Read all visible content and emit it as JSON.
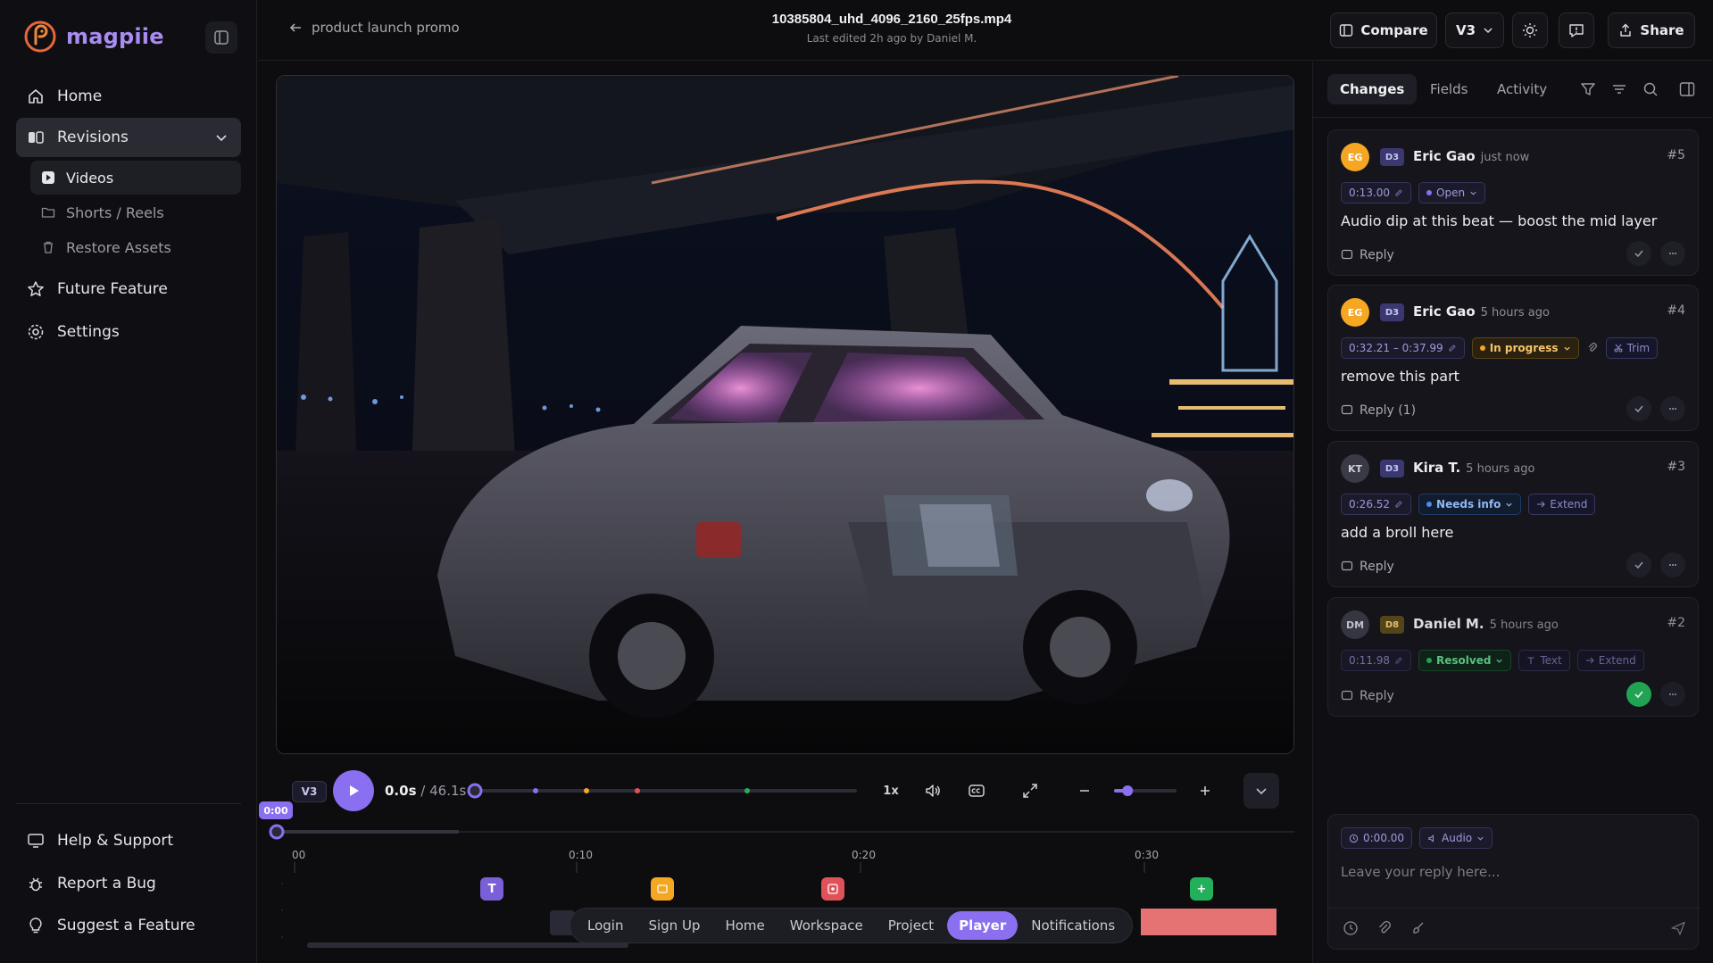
{
  "app": {
    "name": "magpiie"
  },
  "sidebar": {
    "nav": [
      {
        "label": "Home",
        "icon": "home-icon"
      },
      {
        "label": "Revisions",
        "icon": "revisions-icon"
      },
      {
        "label": "Future Feature",
        "icon": "star-icon"
      },
      {
        "label": "Settings",
        "icon": "gear-icon"
      }
    ],
    "sub": [
      {
        "label": "Videos",
        "icon": "play-square-icon"
      },
      {
        "label": "Shorts / Reels",
        "icon": "folder-icon"
      },
      {
        "label": "Restore Assets",
        "icon": "trash-icon"
      }
    ],
    "footer": [
      {
        "label": "Help & Support",
        "icon": "monitor-icon"
      },
      {
        "label": "Report a Bug",
        "icon": "bug-icon"
      },
      {
        "label": "Suggest a Feature",
        "icon": "lightbulb-icon"
      }
    ]
  },
  "header": {
    "back_label": "product launch promo",
    "file_name": "10385804_uhd_4096_2160_25fps.mp4",
    "subtitle": "Last edited 2h ago by Daniel M.",
    "compare_label": "Compare",
    "version_label": "V3",
    "share_label": "Share"
  },
  "player": {
    "version_chip": "V3",
    "current_time": "0.0s",
    "separator": "/",
    "duration": "46.1s",
    "speed": "1x",
    "progress": 0.0,
    "zoom_level": 0.2,
    "playhead_label": "0:00"
  },
  "timeline": {
    "ticks": [
      "00",
      "0:10",
      "0:20",
      "0:30"
    ],
    "markers": [
      {
        "label": "T",
        "color": "#7a5fd8"
      },
      {
        "label": "",
        "color": "#f5a623"
      },
      {
        "label": "",
        "color": "#e0525a"
      },
      {
        "label": "+",
        "color": "#22b15a"
      }
    ],
    "scrubber_dots": [
      "#8a6ff0",
      "#f5a623",
      "#e0525a",
      "#22b15a"
    ]
  },
  "bottom_nav": {
    "items": [
      "Login",
      "Sign Up",
      "Home",
      "Workspace",
      "Project",
      "Player",
      "Notifications"
    ],
    "active": "Player"
  },
  "panel": {
    "tabs": [
      "Changes",
      "Fields",
      "Activity"
    ],
    "active_tab": "Changes",
    "comments": [
      {
        "initials": "EG",
        "avatar_color": "#f5a623",
        "version": "D3",
        "author": "Eric Gao",
        "when": "just now",
        "number": "#5",
        "timestamp": "0:13.00",
        "status": "Open",
        "status_color": "#8a6ff0",
        "tags": [],
        "text": "Audio dip at this beat — boost the mid layer",
        "reply": "Reply",
        "resolved": false
      },
      {
        "initials": "EG",
        "avatar_color": "#f5a623",
        "version": "D3",
        "author": "Eric Gao",
        "when": "5 hours ago",
        "number": "#4",
        "timestamp": "0:32.21 – 0:37.99",
        "status": "In progress",
        "status_color": "#f5a623",
        "tags": [
          "Trim"
        ],
        "text": "remove this part",
        "reply": "Reply (1)",
        "resolved": false
      },
      {
        "initials": "KT",
        "avatar_color": "#3a3a46",
        "version": "D3",
        "author": "Kira T.",
        "when": "5 hours ago",
        "number": "#3",
        "timestamp": "0:26.52",
        "status": "Needs info",
        "status_color": "#4a8cf0",
        "tags": [
          "Extend"
        ],
        "text": "add a broll here",
        "reply": "Reply",
        "resolved": false
      },
      {
        "initials": "DM",
        "avatar_color": "#3a3a46",
        "version": "D8",
        "author": "Daniel M.",
        "when": "5 hours ago",
        "number": "#2",
        "timestamp": "0:11.98",
        "status": "Resolved",
        "status_color": "#22b15a",
        "tags": [
          "Text",
          "Extend"
        ],
        "text": "",
        "reply": "Reply",
        "resolved": true
      }
    ],
    "reply_box": {
      "timestamp": "0:00.00",
      "track": "Audio",
      "placeholder": "Leave your reply here..."
    }
  }
}
